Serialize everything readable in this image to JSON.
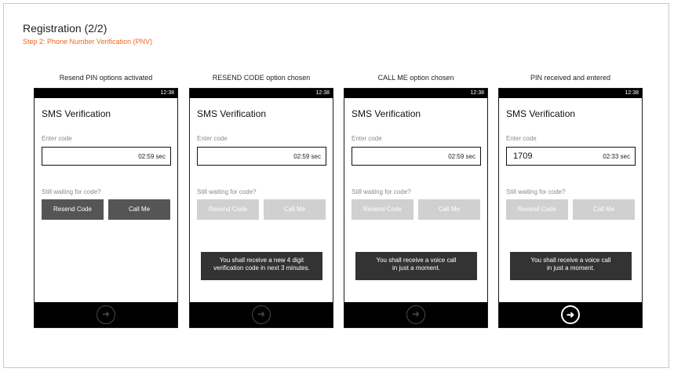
{
  "header": {
    "title": "Registration (2/2)",
    "subtitle": "Step 2: Phone Number Verification (PNV)"
  },
  "colors": {
    "accent": "#f26522",
    "button_active": "#555555",
    "button_disabled": "#d0d0d0",
    "toast_bg": "#333333"
  },
  "screens": [
    {
      "caption": "Resend PIN options activated",
      "time": "12:38",
      "screen_title": "SMS Verification",
      "enter_label": "Enter code",
      "code_value": "",
      "timer": "02:59 sec",
      "waiting": "Still waiting for code?",
      "resend_label": "Resend Code",
      "call_label": "Call Me",
      "buttons_state": "active",
      "toast_line1": "",
      "toast_line2": "",
      "next_state": "disabled",
      "next_icon": "arrow-right-circle-icon"
    },
    {
      "caption": "RESEND CODE option chosen",
      "time": "12:38",
      "screen_title": "SMS Verification",
      "enter_label": "Enter code",
      "code_value": "",
      "timer": "02:59 sec",
      "waiting": "Still waiting for code?",
      "resend_label": "Resend Code",
      "call_label": "Call Me",
      "buttons_state": "disabled",
      "toast_line1": "You shall receive a new 4 digit",
      "toast_line2": "verification code in next 3 minutes.",
      "next_state": "disabled",
      "next_icon": "arrow-right-circle-icon"
    },
    {
      "caption": "CALL ME option chosen",
      "time": "12:38",
      "screen_title": "SMS Verification",
      "enter_label": "Enter code",
      "code_value": "",
      "timer": "02:59 sec",
      "waiting": "Still waiting for code?",
      "resend_label": "Resend Code",
      "call_label": "Call Me",
      "buttons_state": "disabled",
      "toast_line1": "You shall receive a voice call",
      "toast_line2": "in just a moment.",
      "next_state": "disabled",
      "next_icon": "arrow-right-circle-icon"
    },
    {
      "caption": "PIN received and entered",
      "time": "12:38",
      "screen_title": "SMS Verification",
      "enter_label": "Enter code",
      "code_value": "1709",
      "timer": "02:33 sec",
      "waiting": "Still waiting for code?",
      "resend_label": "Resend Code",
      "call_label": "Call Me",
      "buttons_state": "disabled",
      "toast_line1": "You shall receive a voice call",
      "toast_line2": "in just a moment.",
      "next_state": "enabled",
      "next_icon": "arrow-right-circle-icon"
    }
  ]
}
